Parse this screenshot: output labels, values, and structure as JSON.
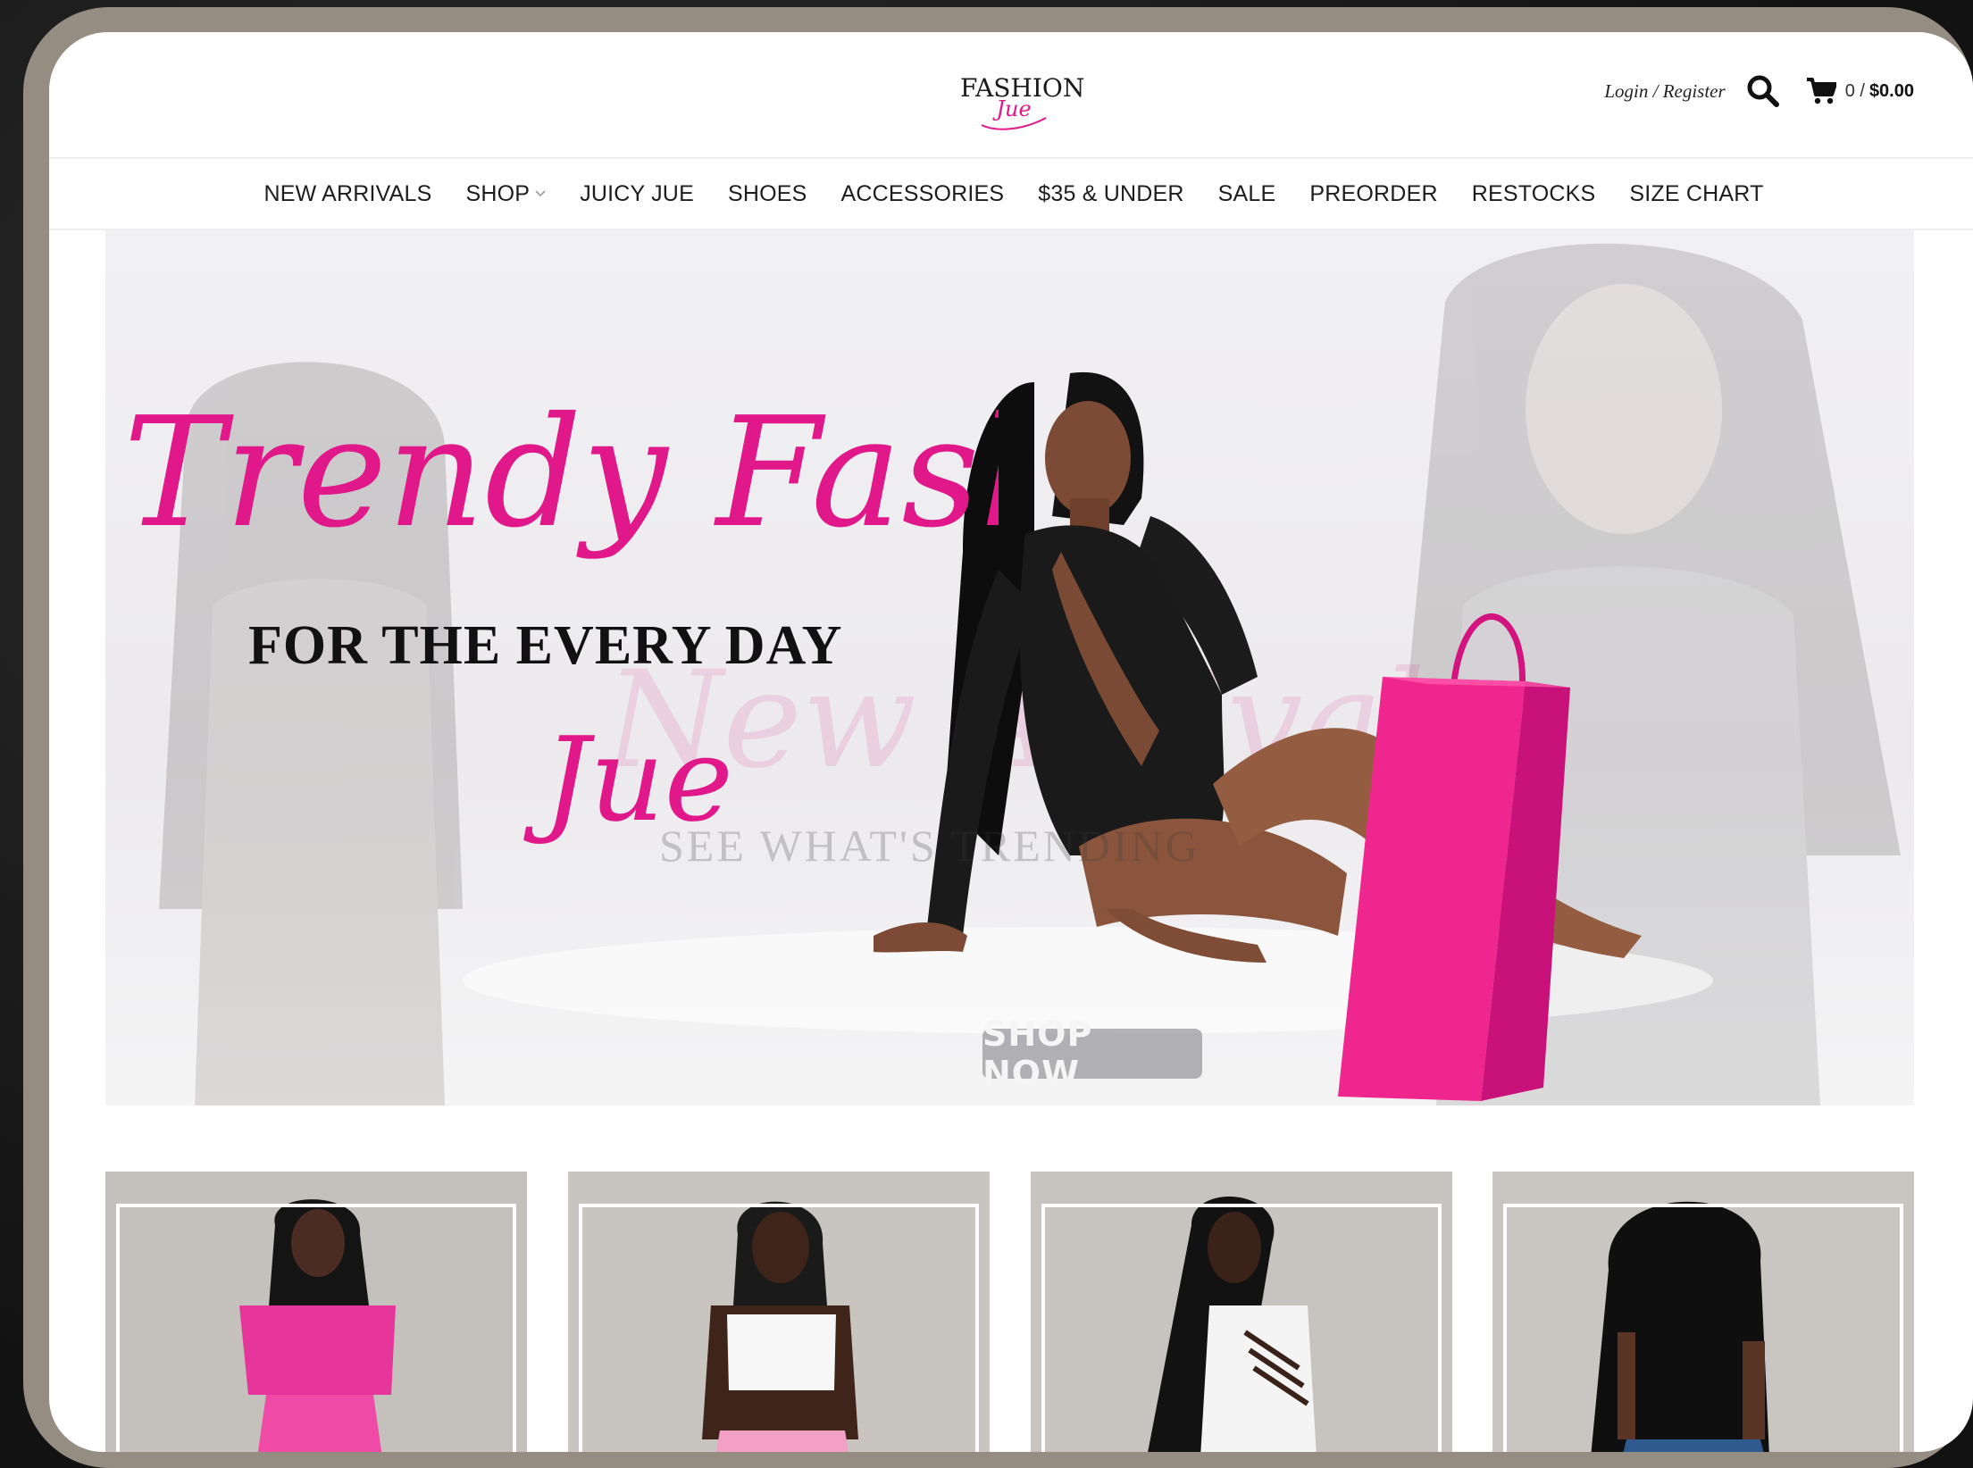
{
  "brand": {
    "logo_main": "FASHION",
    "logo_script": "Jue"
  },
  "header": {
    "login_label": "Login / Register",
    "search_icon": "search-icon",
    "cart_icon": "cart-icon",
    "cart_count": "0 /",
    "cart_total": "$0.00"
  },
  "nav": {
    "items": [
      {
        "label": "NEW ARRIVALS"
      },
      {
        "label": "SHOP",
        "has_dropdown": true
      },
      {
        "label": "JUICY JUE"
      },
      {
        "label": "SHOES"
      },
      {
        "label": "ACCESSORIES"
      },
      {
        "label": "$35 & UNDER"
      },
      {
        "label": "SALE"
      },
      {
        "label": "PREORDER"
      },
      {
        "label": "RESTOCKS"
      },
      {
        "label": "SIZE CHART"
      }
    ]
  },
  "hero": {
    "script_line1": "Trendy Fashion",
    "script_line2": "Jue",
    "subtitle": "FOR THE EVERY DAY",
    "faded_script": "New Arrivals",
    "faded_caption": "SEE WHAT'S TRENDING",
    "cta_label": "SHOP NOW"
  },
  "colors": {
    "accent_pink": "#e0188a",
    "bag_pink": "#f0268f",
    "frame": "#958d82"
  },
  "products": [
    {
      "outfit": "pink top"
    },
    {
      "outfit": "white crop top"
    },
    {
      "outfit": "white cut-out top"
    },
    {
      "outfit": "back view"
    }
  ]
}
